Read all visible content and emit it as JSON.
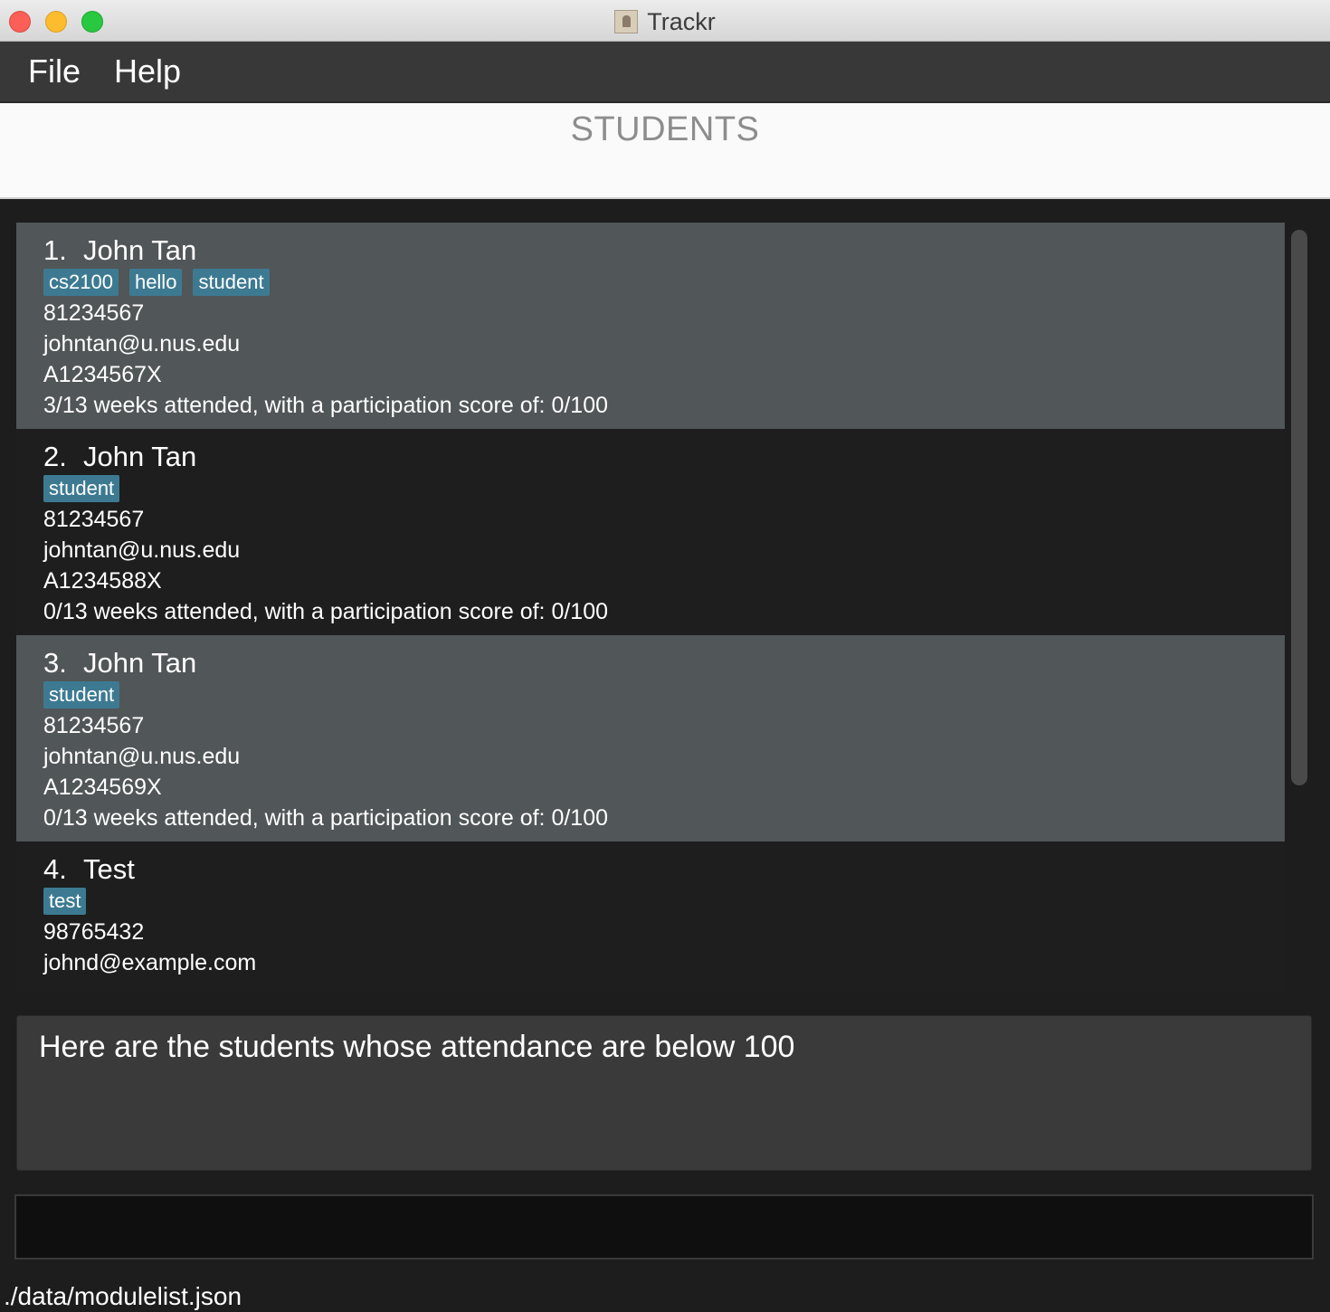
{
  "window": {
    "title": "Trackr",
    "app_icon": "contacts-app-icon"
  },
  "menu": {
    "file": "File",
    "help": "Help"
  },
  "header": {
    "title": "STUDENTS"
  },
  "students": [
    {
      "index": "1.",
      "name": "John Tan",
      "tags": [
        "cs2100",
        "hello",
        "student"
      ],
      "phone": "81234567",
      "email": "johntan@u.nus.edu",
      "student_id": "A1234567X",
      "attendance": "3/13 weeks attended, with a participation score of: 0/100"
    },
    {
      "index": "2.",
      "name": "John Tan",
      "tags": [
        "student"
      ],
      "phone": "81234567",
      "email": "johntan@u.nus.edu",
      "student_id": "A1234588X",
      "attendance": "0/13 weeks attended, with a participation score of: 0/100"
    },
    {
      "index": "3.",
      "name": "John Tan",
      "tags": [
        "student"
      ],
      "phone": "81234567",
      "email": "johntan@u.nus.edu",
      "student_id": "A1234569X",
      "attendance": "0/13 weeks attended, with a participation score of: 0/100"
    },
    {
      "index": "4.",
      "name": "Test",
      "tags": [
        "test"
      ],
      "phone": "98765432",
      "email": "johnd@example.com"
    }
  ],
  "result": {
    "message": "Here are the students whose attendance are below 100"
  },
  "command": {
    "value": ""
  },
  "status": {
    "path": "./data/modulelist.json"
  },
  "colors": {
    "tag": "#3d7a92",
    "card_even": "#515658",
    "card_odd": "#1e1e1e",
    "menubar": "#383838"
  }
}
